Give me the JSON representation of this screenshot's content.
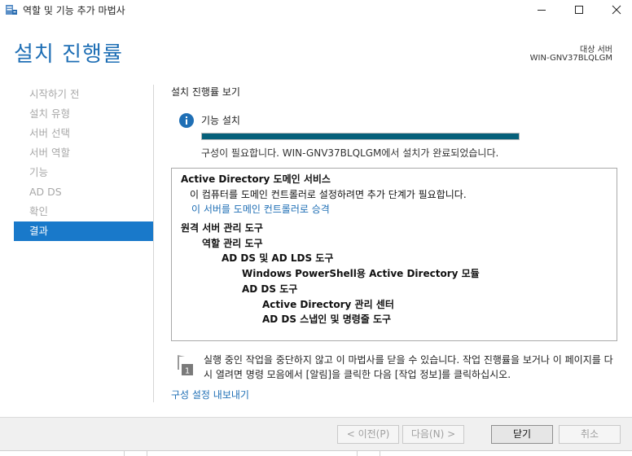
{
  "window": {
    "title": "역할 및 기능 추가 마법사",
    "app_icon": "server-manager-icon"
  },
  "header": {
    "title": "설치 진행률",
    "target_server_label": "대상 서버",
    "target_server_name": "WIN-GNV37BLQLGM"
  },
  "nav": {
    "items": [
      {
        "label": "시작하기 전",
        "active": false
      },
      {
        "label": "설치 유형",
        "active": false
      },
      {
        "label": "서버 선택",
        "active": false
      },
      {
        "label": "서버 역할",
        "active": false
      },
      {
        "label": "기능",
        "active": false
      },
      {
        "label": "AD DS",
        "active": false
      },
      {
        "label": "확인",
        "active": false
      },
      {
        "label": "결과",
        "active": true
      }
    ]
  },
  "main": {
    "section_heading": "설치 진행률 보기",
    "feature_label": "기능 설치",
    "progress_percent": 100,
    "status_text": "구성이 필요합니다. WIN-GNV37BLQLGM에서 설치가 완료되었습니다.",
    "results": [
      {
        "text": "Active Directory 도메인 서비스",
        "cls": "bold"
      },
      {
        "text": "이 컴퓨터를 도메인 컨트롤러로 설정하려면 추가 단계가 필요합니다.",
        "cls": "indent1"
      },
      {
        "text": "이 서버를 도메인 컨트롤러로 승격",
        "cls": "link"
      },
      {
        "text": "원격 서버 관리 도구",
        "cls": "bold gap"
      },
      {
        "text": "역할 관리 도구",
        "cls": "l2"
      },
      {
        "text": "AD DS 및 AD LDS 도구",
        "cls": "l3"
      },
      {
        "text": "Windows PowerShell용 Active Directory 모듈",
        "cls": "l4"
      },
      {
        "text": "AD DS 도구",
        "cls": "l4"
      },
      {
        "text": "Active Directory 관리 센터",
        "cls": "l5"
      },
      {
        "text": "AD DS 스냅인 및 명령줄 도구",
        "cls": "l5"
      }
    ],
    "note_text": "실행 중인 작업을 중단하지 않고 이 마법사를 닫을 수 있습니다. 작업 진행률을 보거나 이 페이지를 다시 열려면 명령 모음에서 [알림]을 클릭한 다음 [작업 정보]를 클릭하십시오.",
    "export_link": "구성 설정 내보내기"
  },
  "footer": {
    "prev_label": "< 이전(P)",
    "next_label": "다음(N) >",
    "close_label": "닫기",
    "cancel_label": "취소"
  },
  "colors": {
    "accent": "#1979ca",
    "title": "#1f6fb5",
    "progress": "#06607a"
  }
}
